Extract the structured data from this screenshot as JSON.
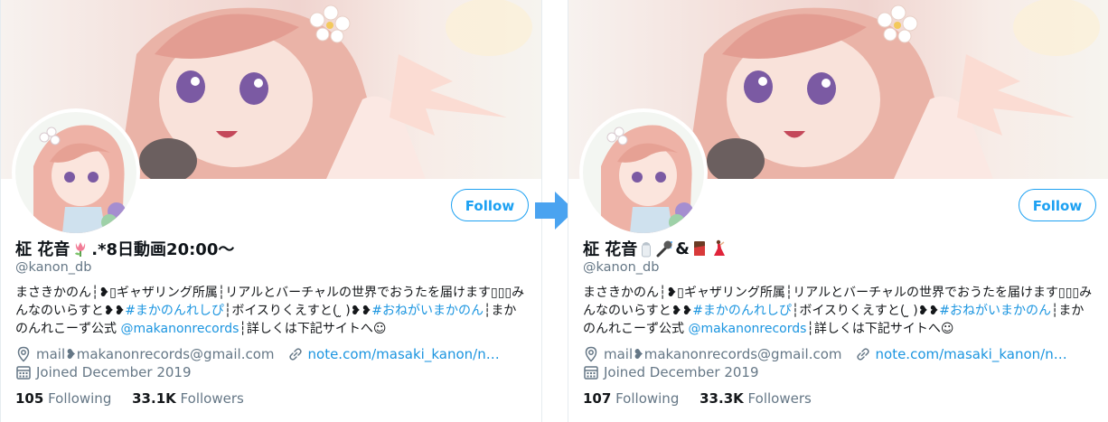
{
  "colors": {
    "accent": "#1da1f2",
    "link": "#1b95e0",
    "muted": "#657786",
    "arrow": "#4aa3f0"
  },
  "before": {
    "name": "柾 花音",
    "name_suffix": ".*8日動画20:00〜",
    "name_emoji_icons": [
      "tulip-icon"
    ],
    "handle": "@kanon_db",
    "follow_label": "Follow",
    "bio": {
      "line1_text": "まさきかのん┆❥▯ギャザリング所属┆リアルとバーチャルの世界でおうたを届けます▯▯▯みんなのいらすと❥❥",
      "tag1": "#まかのんれしぴ",
      "mid_text": "┆ボイスりくえすと( ̫ )❥❥",
      "tag2": "#おねがいまかのん",
      "mid2_text": "┆まかのんれこーず公式 ",
      "mention": "@makanonrecords",
      "end_text": "┆詳しくは下記サイトへ☺"
    },
    "location": "mail❥makanonrecords@gmail.com",
    "website": "note.com/masaki_kanon/n…",
    "joined": "Joined December 2019",
    "following_count": "105",
    "following_label": "Following",
    "followers_count": "33.1K",
    "followers_label": "Followers"
  },
  "after": {
    "name": "柾 花音",
    "name_suffix": "&",
    "name_emoji_icons": [
      "salt-shaker-icon",
      "microphone-icon",
      "chocolate-bar-icon",
      "dancer-icon"
    ],
    "handle": "@kanon_db",
    "follow_label": "Follow",
    "bio": {
      "line1_text": "まさきかのん┆❥▯ギャザリング所属┆リアルとバーチャルの世界でおうたを届けます▯▯▯みんなのいらすと❥❥",
      "tag1": "#まかのんれしぴ",
      "mid_text": "┆ボイスりくえすと( ̫ )❥❥",
      "tag2": "#おねがいまかのん",
      "mid2_text": "┆まかのんれこーず公式 ",
      "mention": "@makanonrecords",
      "end_text": "┆詳しくは下記サイトへ☺"
    },
    "location": "mail❥makanonrecords@gmail.com",
    "website": "note.com/masaki_kanon/n…",
    "joined": "Joined December 2019",
    "following_count": "107",
    "following_label": "Following",
    "followers_count": "33.3K",
    "followers_label": "Followers"
  }
}
